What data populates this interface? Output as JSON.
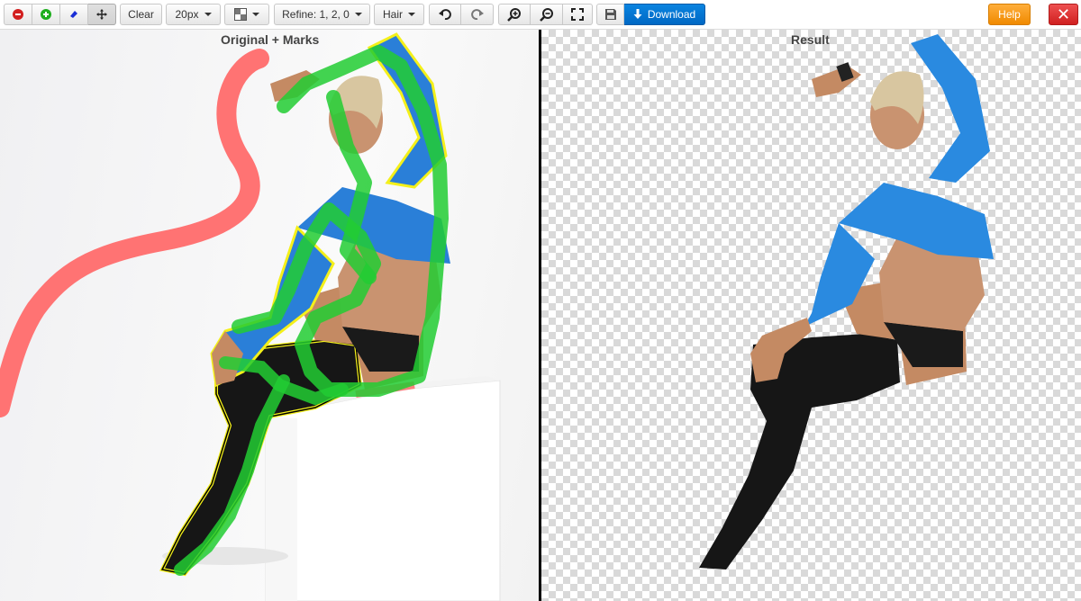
{
  "toolbar": {
    "size_label": "20px",
    "clear_label": "Clear",
    "refine_label": "Refine: 1, 2, 0",
    "hair_label": "Hair",
    "download_label": "Download",
    "help_label": "Help",
    "close_glyph": "✕"
  },
  "panels": {
    "left_title": "Original + Marks",
    "right_title": "Result"
  },
  "colors": {
    "remove_mark": "#ff6b6b",
    "keep_mark": "#22cc33",
    "outline": "#f4f01a",
    "download": "#0a7bd8",
    "help": "#f59a1a",
    "close": "#e03030"
  },
  "icons": {
    "remove": "minus-circle-icon",
    "add": "plus-circle-icon",
    "eraser": "eraser-icon",
    "move": "move-icon",
    "background": "checkerboard-icon",
    "undo": "undo-icon",
    "redo": "redo-icon",
    "zoom_in": "zoom-in-icon",
    "zoom_out": "zoom-out-icon",
    "fit": "fullscreen-icon",
    "save": "save-icon",
    "download": "download-arrow-icon"
  }
}
